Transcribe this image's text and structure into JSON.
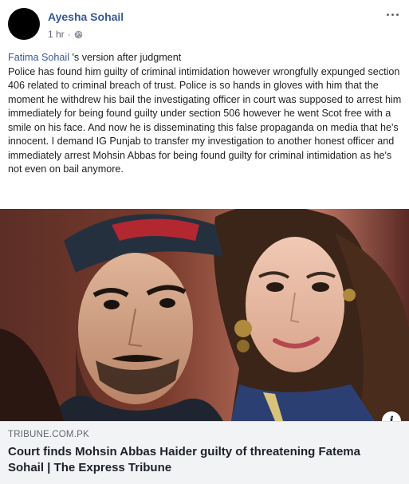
{
  "post": {
    "author": "Ayesha Sohail",
    "timestamp": "1 hr",
    "separator": "·",
    "privacy_icon": "globe-icon",
    "menu_icon": "more-options-icon",
    "mention": "Fatima Sohail",
    "text_after_mention": " 's version after judgment",
    "body": "Police has found him guilty of criminal intimidation however wrongfully expunged section 406 related to criminal breach of trust. Police is so hands in gloves with him that the moment he withdrew his bail the investigating officer in court was supposed to arrest him immediately for being found guilty under section 506 however he went Scot free with a smile on his face. And now he is disseminating this false propaganda on media that he's innocent. I demand IG Punjab to transfer my investigation to another honest officer and immediately arrest Mohsin Abbas for being found guilty for criminal intimidation as he's not even on bail anymore."
  },
  "link_preview": {
    "info_icon": "info-icon",
    "info_label": "i",
    "domain": "TRIBUNE.COM.PK",
    "headline": "Court finds Mohsin Abbas Haider guilty of threatening Fatema Sohail | The Express Tribune"
  },
  "colors": {
    "author": "#385898",
    "meta": "#616770",
    "card_bg": "#f2f3f5"
  }
}
